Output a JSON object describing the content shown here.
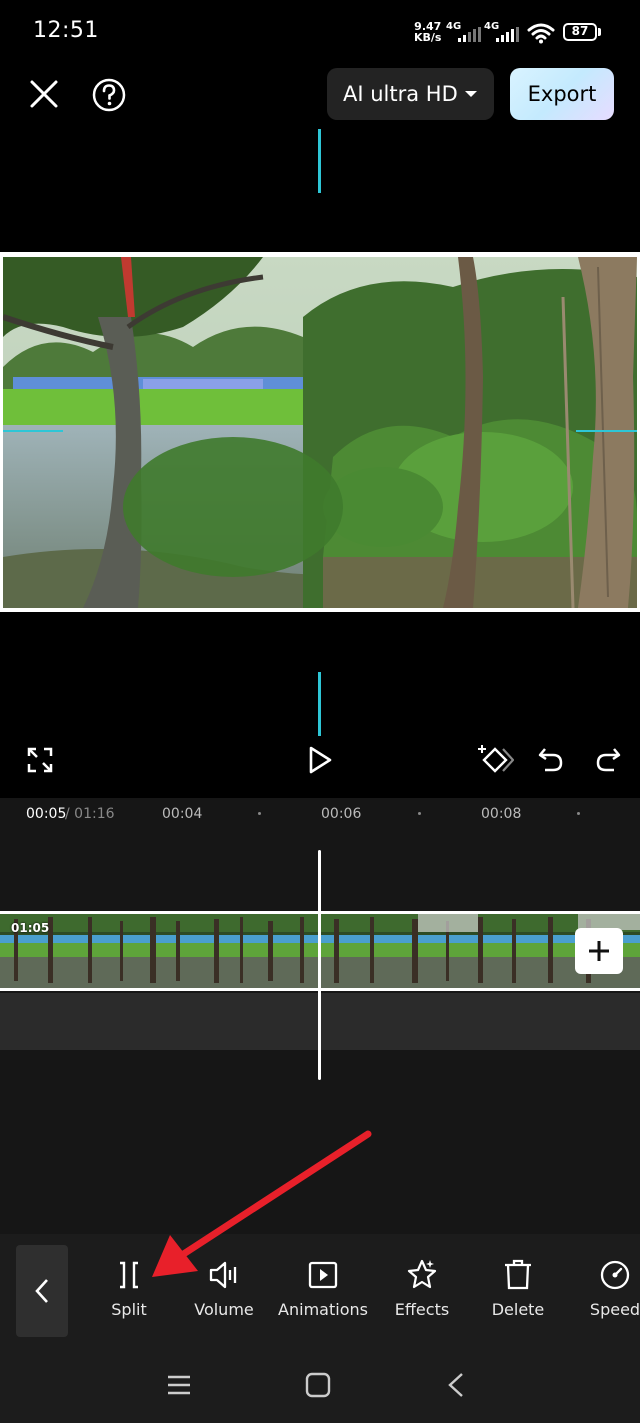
{
  "status_bar": {
    "time": "12:51",
    "net_speed_value": "9.47",
    "net_speed_unit": "KB/s",
    "sim1_label": "4G",
    "sim2_label": "4G",
    "battery_level": "87"
  },
  "top_bar": {
    "close_icon": "close-icon",
    "help_icon": "help-icon",
    "quality_label": "AI ultra HD",
    "export_label": "Export"
  },
  "timeline": {
    "current_time": "00:05",
    "separator_total": " / 01:16",
    "ticks": [
      "00:04",
      "00:06",
      "00:08"
    ],
    "clip_duration": "01:05"
  },
  "toolbar": {
    "items": [
      {
        "label": "Split",
        "icon": "split-icon"
      },
      {
        "label": "Volume",
        "icon": "volume-icon"
      },
      {
        "label": "Animations",
        "icon": "animations-icon"
      },
      {
        "label": "Effects",
        "icon": "effects-icon"
      },
      {
        "label": "Delete",
        "icon": "delete-icon"
      },
      {
        "label": "Speed",
        "icon": "speed-icon"
      }
    ]
  },
  "colors": {
    "accent_cyan": "#2ec6d6",
    "annotation_arrow": "#e8202a",
    "export_gradient_start": "#d9f3ff"
  }
}
